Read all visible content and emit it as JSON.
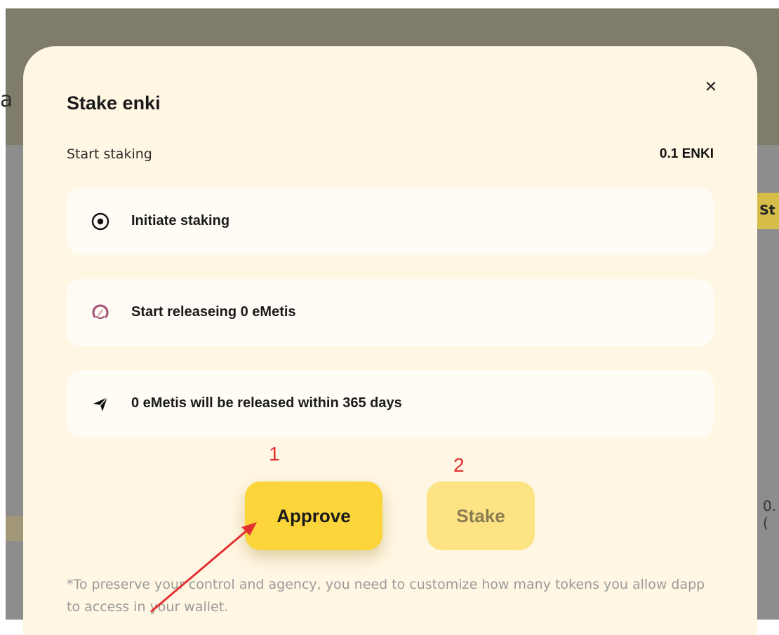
{
  "background": {
    "left_fragment": "a",
    "right_button_fragment": "St",
    "right_number_fragment": "0.("
  },
  "modal": {
    "title": "Stake enki",
    "close_icon": "close-icon",
    "summary_label": "Start staking",
    "summary_value": "0.1 ENKI",
    "steps": [
      {
        "icon": "radio-target-icon",
        "label": "Initiate staking"
      },
      {
        "icon": "wheat-token-icon",
        "label": "Start releaseing 0 eMetis"
      },
      {
        "icon": "paper-plane-icon",
        "label": "0 eMetis will be released within 365 days"
      }
    ],
    "annotations": [
      "1",
      "2"
    ],
    "approve_label": "Approve",
    "stake_label": "Stake",
    "note": "*To preserve your control and agency, you need to customize how many tokens you allow dapp to access in your wallet."
  },
  "colors": {
    "modal_bg": "#fff7e3",
    "approve": "#fcd53b",
    "stake_disabled": "#fde383",
    "annotation": "#e03030"
  }
}
